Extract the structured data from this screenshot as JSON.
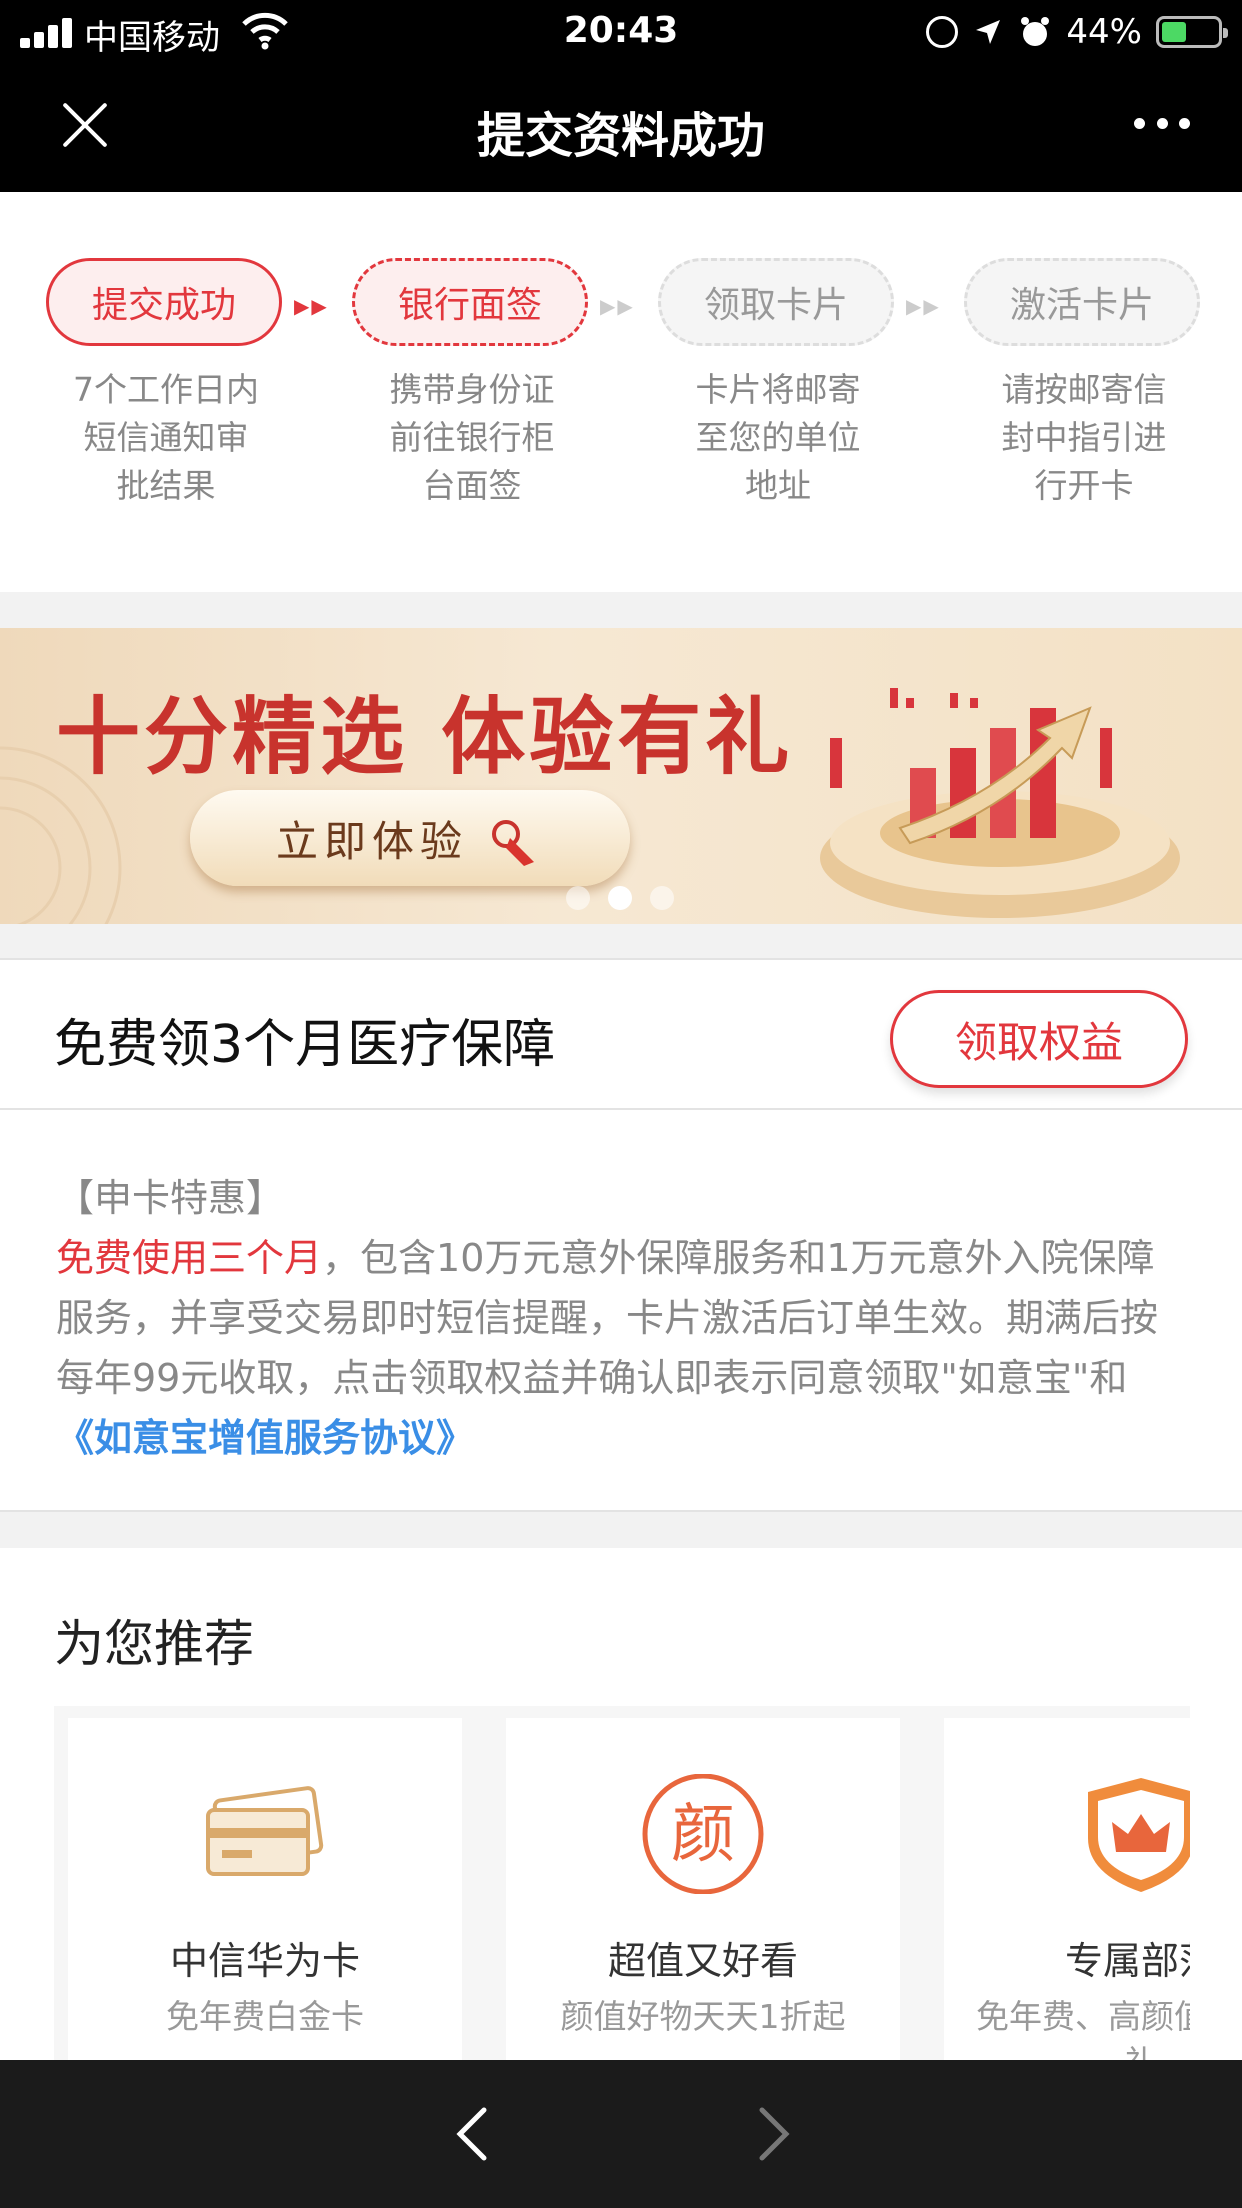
{
  "status_bar": {
    "carrier": "中国移动",
    "time": "20:43",
    "battery": "44%",
    "battery_level": 0.44
  },
  "nav": {
    "title": "提交资料成功"
  },
  "steps": [
    {
      "label": "提交成功",
      "desc": "7个工作日内\n短信通知审\n批结果",
      "state": "done"
    },
    {
      "label": "银行面签",
      "desc": "携带身份证\n前往银行柜\n台面签",
      "state": "current"
    },
    {
      "label": "领取卡片",
      "desc": "卡片将邮寄\n至您的单位\n地址",
      "state": "todo"
    },
    {
      "label": "激活卡片",
      "desc": "请按邮寄信\n封中指引进\n行开卡",
      "state": "todo"
    }
  ],
  "banner": {
    "title": "十分精选  体验有礼",
    "button": "立即体验",
    "page_index": 1,
    "page_count": 3
  },
  "benefit": {
    "title": "免费领3个月医疗保障",
    "button": "领取权益"
  },
  "terms": {
    "heading": "【申卡特惠】",
    "highlight": "免费使用三个月",
    "body": "，包含10万元意外保障服务和1万元意外入院保障服务，并享受交易即时短信提醒，卡片激活后订单生效。期满后按每年99元收取，点击领取权益并确认即表示同意领取\"如意宝\"和",
    "link": "《如意宝增值服务协议》"
  },
  "recommend": {
    "title": "为您推荐",
    "cards": [
      {
        "title": "中信华为卡",
        "subtitle": "免年费白金卡",
        "icon": "card-icon"
      },
      {
        "title": "超值又好看",
        "subtitle": "颜值好物天天1折起",
        "icon": "yan-badge-icon"
      },
      {
        "title": "专属部落",
        "subtitle": "免年费、高颜值，享好礼",
        "icon": "crown-shield-icon"
      }
    ]
  },
  "colors": {
    "accent": "#e2373d",
    "link": "#3a8ee6",
    "nav_bg": "#000000",
    "toolbar_bg": "#1b1b1b"
  }
}
